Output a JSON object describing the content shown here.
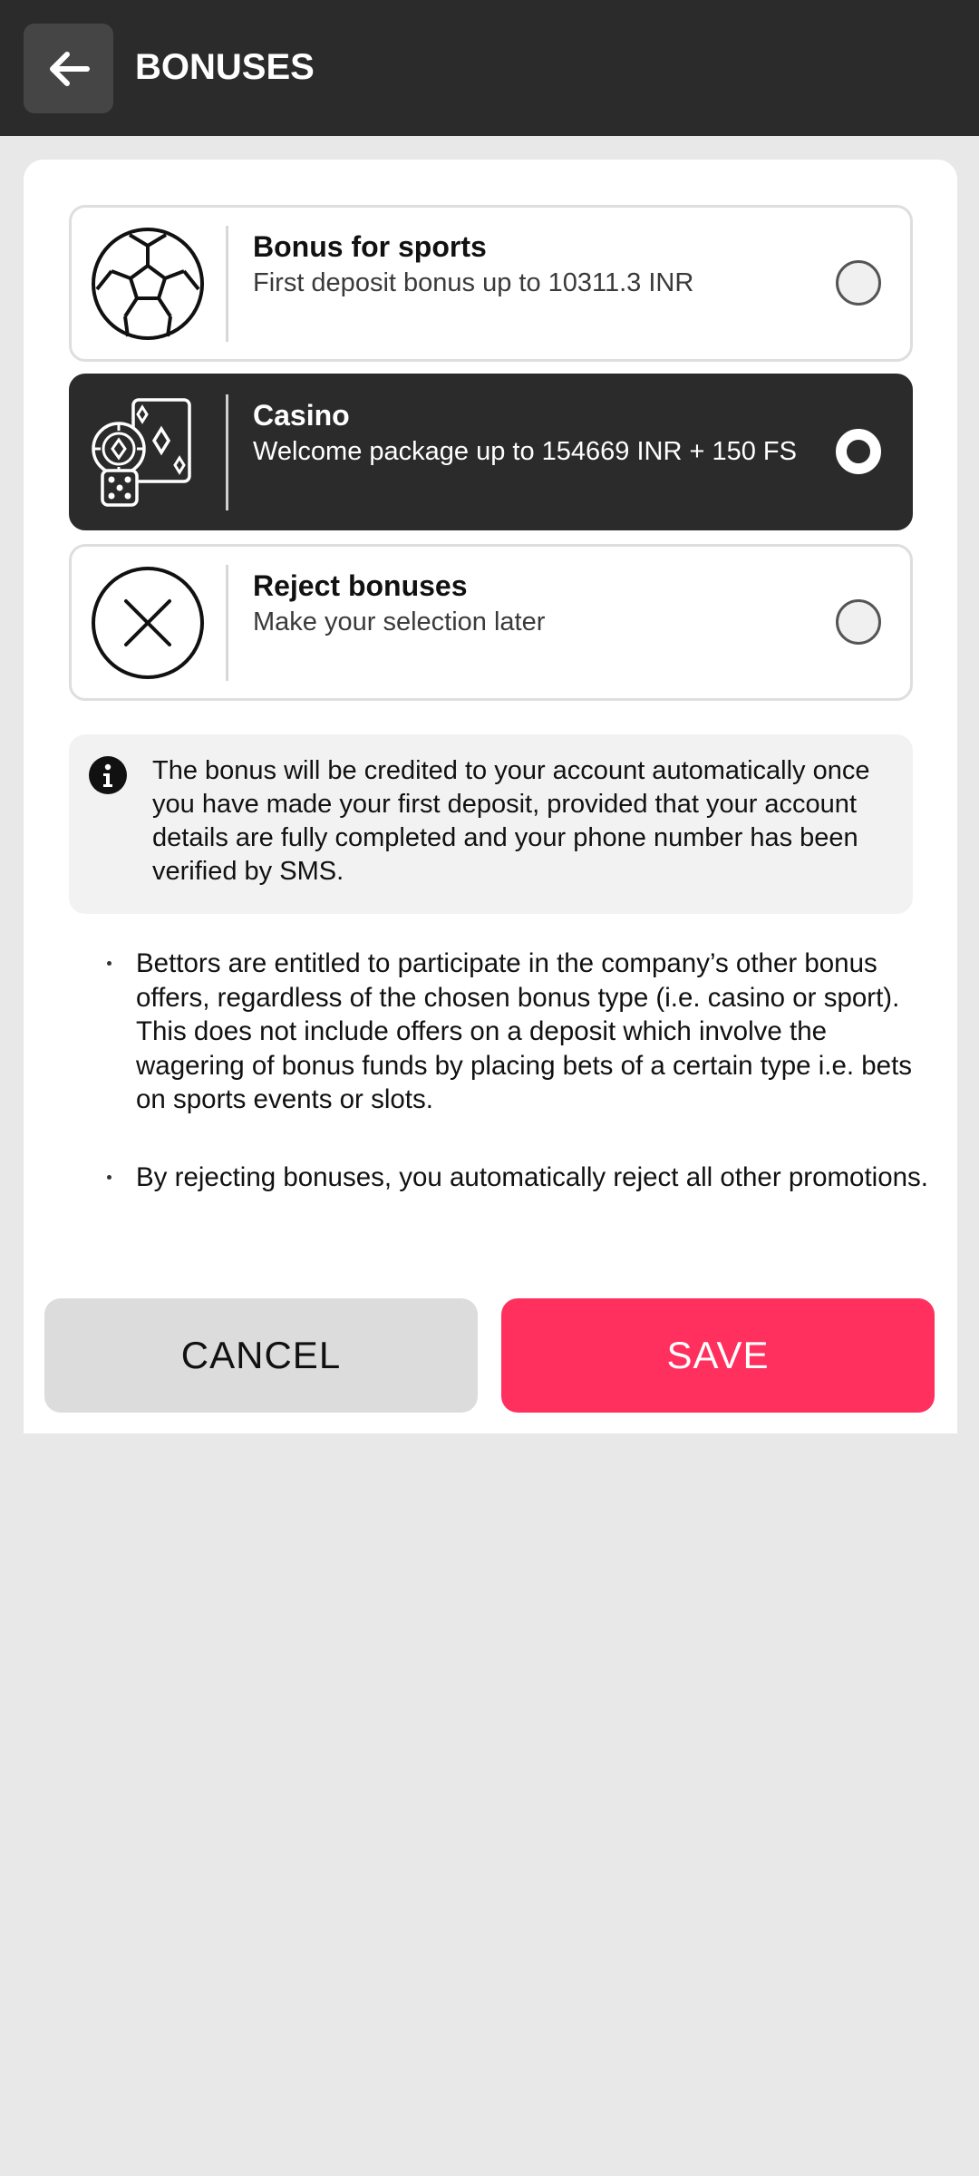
{
  "header": {
    "title": "BONUSES",
    "back_icon": "arrow-left-icon"
  },
  "options": [
    {
      "title": "Bonus for sports",
      "subtitle": "First deposit bonus up to 10311.3 INR",
      "icon": "soccer-ball-icon",
      "selected": false
    },
    {
      "title": "Casino",
      "subtitle": "Welcome package up to 154669 INR + 150 FS",
      "icon": "casino-chip-cards-dice-icon",
      "selected": true
    },
    {
      "title": "Reject bonuses",
      "subtitle": "Make your selection later",
      "icon": "circle-x-icon",
      "selected": false
    }
  ],
  "info": {
    "icon": "info-icon",
    "text": "The bonus will be credited to your account automatically once you have made your first deposit, provided that your account details are fully completed and your phone number has been verified by SMS."
  },
  "bullets": [
    "Bettors are entitled to participate in the company’s other bonus offers, regardless of the chosen bonus type (i.e. casino or sport). This does not include offers on a deposit which involve the wagering of bonus funds by placing bets of a certain type i.e. bets on sports events or slots.",
    "By rejecting bonuses, you automatically reject all other promotions."
  ],
  "footer": {
    "cancel_label": "CANCEL",
    "save_label": "SAVE"
  },
  "colors": {
    "header_bg": "#2b2b2b",
    "save_bg": "#ff2f5e",
    "cancel_bg": "#dcdcdc",
    "page_bg": "#e8e8e8"
  }
}
